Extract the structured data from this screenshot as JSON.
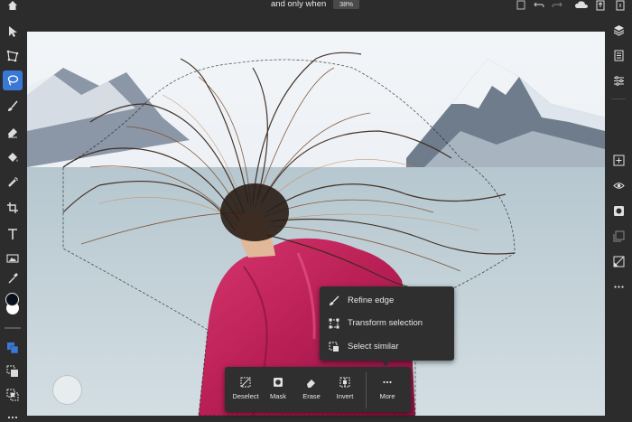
{
  "header": {
    "document_title": "and only when",
    "zoom_level": "38%",
    "icons": [
      "home-icon",
      "share-icon",
      "undo-icon",
      "redo-icon",
      "cloud-icon",
      "export-icon",
      "help-icon"
    ]
  },
  "left_toolbar": {
    "tools": [
      "move-tool-icon",
      "transform-tool-icon",
      "lasso-select-icon",
      "brush-icon",
      "eraser-icon",
      "fill-icon",
      "healing-icon",
      "crop-icon",
      "type-icon",
      "place-image-icon",
      "eyedropper-icon"
    ],
    "active_tool": "lasso-select-icon",
    "foreground_color": "#0a0f1e",
    "background_color": "#ffffff",
    "bottom_tools": [
      "selection-mode-add-icon",
      "selection-mode-subtract-icon",
      "selection-mode-intersect-icon",
      "more-icon"
    ]
  },
  "right_toolbar": {
    "tools": [
      "layers-icon",
      "layer-properties-icon",
      "adjustments-icon",
      "add-layer-icon",
      "visibility-icon",
      "mask-icon",
      "clipping-icon",
      "layer-lock-icon",
      "more-icon"
    ]
  },
  "context_menu": {
    "items": [
      {
        "label": "Refine edge",
        "icon": "brush-icon"
      },
      {
        "label": "Transform selection",
        "icon": "transform-icon"
      },
      {
        "label": "Select similar",
        "icon": "select-similar-icon"
      }
    ]
  },
  "task_bar": {
    "items": [
      {
        "label": "Deselect",
        "icon": "deselect-icon"
      },
      {
        "label": "Mask",
        "icon": "mask-icon"
      },
      {
        "label": "Erase",
        "icon": "erase-icon"
      },
      {
        "label": "Invert",
        "icon": "invert-icon"
      },
      {
        "label": "More",
        "icon": "more-icon"
      }
    ]
  },
  "colors": {
    "accent": "#3a78d6",
    "panel_bg": "#2c2c2c",
    "text": "#e6e6e6"
  }
}
